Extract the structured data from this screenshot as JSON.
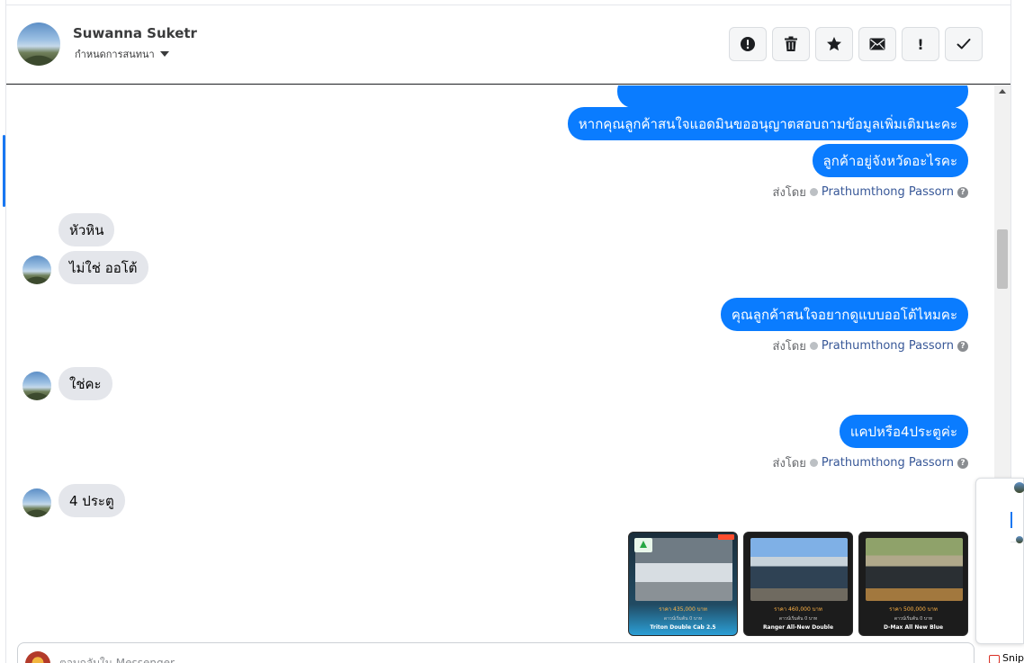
{
  "header": {
    "contact_name": "Suwanna Suketr",
    "conversation_setting_label": "กำหนดการสนทนา",
    "actions": [
      {
        "name": "report",
        "icon": "exclamation-circle-icon"
      },
      {
        "name": "delete",
        "icon": "trash-icon"
      },
      {
        "name": "star",
        "icon": "star-icon"
      },
      {
        "name": "mark-unread",
        "icon": "envelope-icon"
      },
      {
        "name": "important",
        "icon": "exclamation-icon",
        "glyph": "!"
      },
      {
        "name": "done",
        "icon": "check-icon"
      }
    ]
  },
  "messages": {
    "out_1": "หากคุณลูกค้าสนใจแอดมินขออนุญาตสอบถามข้อมูลเพิ่มเติมนะคะ",
    "out_2": "ลูกค้าอยู่จังหวัดอะไรคะ",
    "in_1": "หัวหิน",
    "in_2": "ไม่ใช่ ออโต้",
    "out_3": "คุณลูกค้าสนใจอยากดูแบบออโต้ไหมคะ",
    "in_3": "ใช่คะ",
    "out_4": "แคปหรือ4ประตูค่ะ",
    "in_4": "4 ประตู"
  },
  "sent_by": {
    "label": "ส่งโดย",
    "agent": "Prathumthong Passorn",
    "help_glyph": "?"
  },
  "car_cards": [
    {
      "price": "ราคา 435,000 บาท",
      "note": "ดาวน์เริ่มต้น 0 บาท",
      "model": "Triton Double Cab 2.5"
    },
    {
      "price": "ราคา 460,000 บาท",
      "note": "ดาวน์เริ่มต้น 0 บาท",
      "model": "Ranger All-New Double"
    },
    {
      "price": "ราคา 500,000 บาท",
      "note": "ดาวน์เริ่มต้น 0 บาท",
      "model": "D-Max All New Blue"
    }
  ],
  "composer": {
    "placeholder": "ตอบกลับใน Messenger"
  },
  "taskbar": {
    "snip_label": "Snip"
  },
  "colors": {
    "outgoing_bubble": "#0a7cff",
    "incoming_bubble": "#e4e6eb",
    "agent_link": "#385898"
  }
}
